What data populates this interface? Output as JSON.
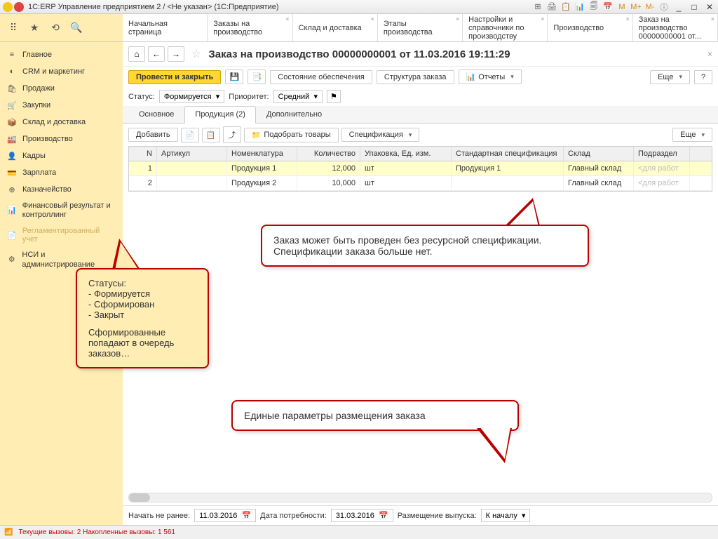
{
  "titlebar": {
    "text": "1С:ERP Управление предприятием 2 / <Не указан> (1С:Предприятие)",
    "sysicons": [
      "M",
      "M+",
      "M-"
    ]
  },
  "toptabs": [
    {
      "label": "Начальная страница"
    },
    {
      "label": "Заказы на производство"
    },
    {
      "label": "Склад и доставка"
    },
    {
      "label": "Этапы производства"
    },
    {
      "label": "Настройки и справочники по производству"
    },
    {
      "label": "Производство"
    },
    {
      "label": "Заказ на производство 00000000001 от..."
    }
  ],
  "sidebar": [
    {
      "icon": "≡",
      "label": "Главное"
    },
    {
      "icon": "◐",
      "label": "CRM и маркетинг"
    },
    {
      "icon": "🛍",
      "label": "Продажи"
    },
    {
      "icon": "🛒",
      "label": "Закупки"
    },
    {
      "icon": "📦",
      "label": "Склад и доставка"
    },
    {
      "icon": "🏭",
      "label": "Производство"
    },
    {
      "icon": "👤",
      "label": "Кадры"
    },
    {
      "icon": "💳",
      "label": "Зарплата"
    },
    {
      "icon": "⊕",
      "label": "Казначейство"
    },
    {
      "icon": "📊",
      "label": "Финансовый результат и контроллинг"
    },
    {
      "icon": "📄",
      "label": "Регламентированный учет"
    },
    {
      "icon": "⚙",
      "label": "НСИ и администрирование"
    }
  ],
  "document": {
    "title": "Заказ на производство 00000000001 от 11.03.2016 19:11:29",
    "submit": "Провести и закрыть",
    "state_label": "Состояние обеспечения",
    "structure_label": "Структура заказа",
    "reports_label": "Отчеты",
    "more": "Еще",
    "status_label": "Статус:",
    "status_value": "Формируется",
    "priority_label": "Приоритет:",
    "priority_value": "Средний"
  },
  "subtabs": [
    {
      "label": "Основное"
    },
    {
      "label": "Продукция (2)"
    },
    {
      "label": "Дополнительно"
    }
  ],
  "table_toolbar": {
    "add": "Добавить",
    "pick": "Подобрать товары",
    "spec": "Спецификация",
    "more": "Еще"
  },
  "table": {
    "headers": {
      "n": "N",
      "art": "Артикул",
      "nom": "Номенклатура",
      "qty": "Количество",
      "pack": "Упаковка, Ед. изм.",
      "spec": "Стандартная спецификация",
      "wh": "Склад",
      "dept": "Подраздел"
    },
    "rows": [
      {
        "n": "1",
        "art": "",
        "nom": "Продукция 1",
        "qty": "12,000",
        "pack": "шт",
        "spec": "Продукция 1",
        "wh": "Главный склад",
        "dept": "<для работ"
      },
      {
        "n": "2",
        "art": "",
        "nom": "Продукция 2",
        "qty": "10,000",
        "pack": "шт",
        "spec": "",
        "wh": "Главный склад",
        "dept": "<для работ"
      }
    ]
  },
  "bottom": {
    "start_label": "Начать не ранее:",
    "start_value": "11.03.2016",
    "need_label": "Дата потребности:",
    "need_value": "31.03.2016",
    "place_label": "Размещение выпуска:",
    "place_value": "К началу"
  },
  "statusbar": {
    "text": "Текущие вызовы: 2   Накопленные вызовы: 1 561"
  },
  "callouts": {
    "c1_l1": "Статусы:",
    "c1_l2": "- Формируется",
    "c1_l3": "- Сформирован",
    "c1_l4": "- Закрыт",
    "c1_l5": "Сформированные попадают в очередь заказов…",
    "c2": "Заказ может быть проведен без ресурсной спецификации. Спецификации заказа больше нет.",
    "c3": "Единые параметры размещения заказа"
  }
}
